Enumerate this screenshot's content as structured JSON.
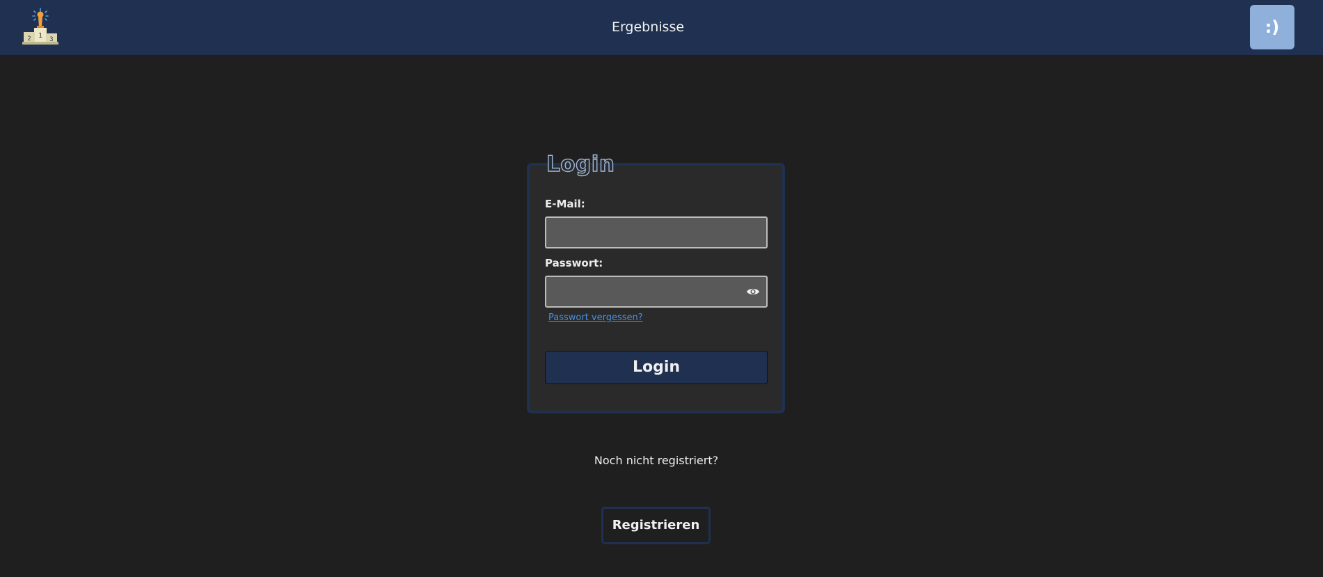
{
  "header": {
    "logo_icon": "podium-trophy-icon",
    "title": "Ergebnisse",
    "user_button_label": ":)",
    "background_color": "#1f3050"
  },
  "login_form": {
    "title": "Login",
    "email_label": "E-Mail:",
    "email_value": "",
    "password_label": "Passwort:",
    "password_value": "",
    "password_toggle_icon": "eye-icon",
    "forgot_password_link": "Passwort vergessen?",
    "submit_label": "Login"
  },
  "register": {
    "prompt": "Noch nicht registriert?",
    "button_label": "Registrieren"
  },
  "colors": {
    "page_background": "#1f1f1f",
    "card_background": "#2a2a2a",
    "accent": "#1f3050",
    "avatar_button": "#8fb0da",
    "link": "#4a8fe0"
  }
}
